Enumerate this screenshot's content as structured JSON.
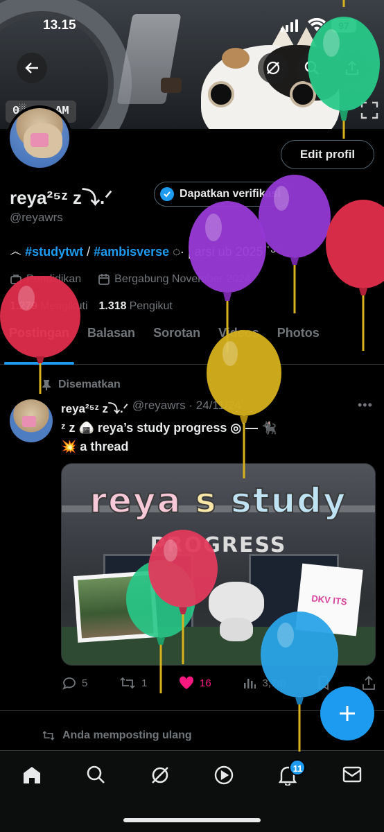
{
  "status_bar": {
    "time": "13.15",
    "battery": "97"
  },
  "banner": {
    "timestamp": "0░:52 AM"
  },
  "profile": {
    "display_name": "reya²⁵ᶻ z⤵︎.ᐟ",
    "verify_label": "Dapatkan verifikasi",
    "handle": "@reyawrs",
    "edit_label": "Edit profil",
    "bio_prefix": "෴ ",
    "bio_tag1": "#studytwt",
    "bio_sep": " / ",
    "bio_tag2": "#ambisverse",
    "bio_suffix": " ◌· | arsi ub 2025 ˙ᵕ˙",
    "category": "Pendidikan",
    "joined": "Bergabung November 2024",
    "following_count": "1.279",
    "following_label": "Mengikuti",
    "followers_count": "1.318",
    "followers_label": "Pengikut"
  },
  "tabs": [
    {
      "label": "Postingan"
    },
    {
      "label": "Balasan"
    },
    {
      "label": "Sorotan"
    },
    {
      "label": "Videos"
    },
    {
      "label": "Photos"
    }
  ],
  "pinned_post": {
    "pinned_label": "Disematkan",
    "author": "reya²⁵ᶻ z⤵︎.ᐟ",
    "handle_date": "@reyawrs · 24/11/24",
    "line1": "ᶻ z 🍙 reya’s study progress ◎˙— 🐈‍⬛",
    "line2": "💥 a thread",
    "media": {
      "title_a": "reya",
      "title_s": "s",
      "title_b": "study",
      "subtitle": "PROGRESS",
      "badge": "DKV ITS"
    },
    "replies": "5",
    "reposts": "1",
    "likes": "16",
    "views": "3,7rb"
  },
  "repost_note": "Anda memposting ulang",
  "notification_count": "11",
  "colors": {
    "accent": "#1d9bf0",
    "like": "#f91880",
    "balloons": [
      "#2ad18a",
      "#9b3fd8",
      "#e0304a",
      "#d9b21f",
      "#e23a52",
      "#2aa3e8"
    ]
  },
  "icons": {
    "back": "arrow-left-icon",
    "grok": "grok-icon",
    "search": "search-icon",
    "share": "share-icon",
    "focus": "focus-frame-icon",
    "verified": "verified-badge-icon",
    "calendar": "calendar-icon",
    "category": "briefcase-icon",
    "pin": "pin-icon",
    "reply": "reply-icon",
    "repost": "repost-icon",
    "like": "heart-icon",
    "views": "views-icon",
    "bookmark": "bookmark-icon",
    "upload": "upload-icon",
    "compose": "plus-icon",
    "home": "home-icon",
    "explore": "search-icon",
    "grok_nav": "grok-icon",
    "video": "play-icon",
    "notifications": "bell-icon",
    "messages": "mail-icon"
  }
}
